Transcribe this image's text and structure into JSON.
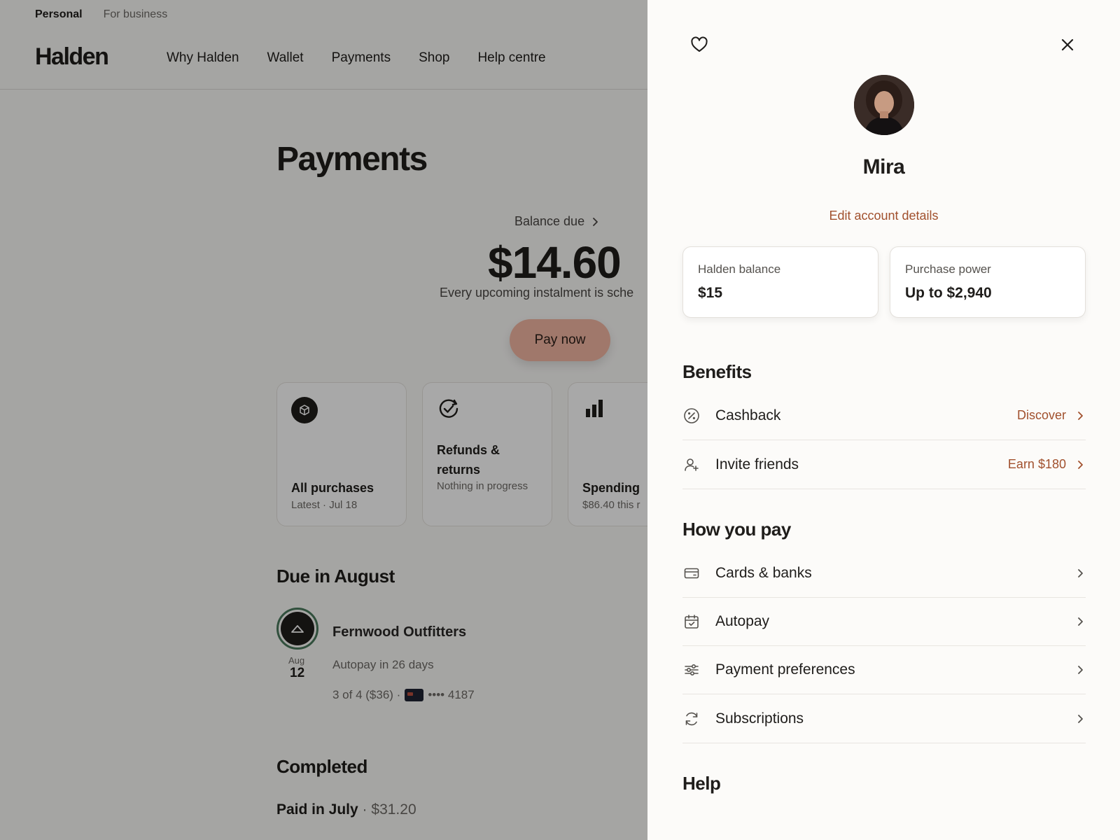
{
  "topbar": {
    "personal": "Personal",
    "business": "For business"
  },
  "header": {
    "logo": "Halden",
    "nav": [
      "Why Halden",
      "Wallet",
      "Payments",
      "Shop",
      "Help centre"
    ]
  },
  "main": {
    "title": "Payments",
    "balance_label": "Balance due",
    "balance_amount": "$14.60",
    "balance_note": "Every upcoming instalment is sche",
    "pay_button": "Pay now",
    "tiles": [
      {
        "title": "All purchases",
        "sub": "Latest · Jul 18"
      },
      {
        "title": "Refunds & returns",
        "sub": "Nothing in progress"
      },
      {
        "title": "Spending",
        "sub": "$86.40 this r"
      }
    ],
    "due_section": "Due in August",
    "due_item": {
      "month": "Aug",
      "day": "12",
      "merchant": "Fernwood Outfitters",
      "autopay": "Autopay in 26 days",
      "installment": "3 of 4 ($36) ·",
      "card_last4": "•••• 4187"
    },
    "completed_section": "Completed",
    "paid_label": "Paid in July",
    "paid_sep": "·",
    "paid_amount": "$31.20"
  },
  "panel": {
    "name": "Mira",
    "edit_link": "Edit account details",
    "halden_balance_label": "Halden balance",
    "halden_balance_value": "$15",
    "purchase_power_label": "Purchase power",
    "purchase_power_value": "Up to $2,940",
    "benefits_title": "Benefits",
    "benefits": [
      {
        "label": "Cashback",
        "action": "Discover",
        "icon": "percent-icon"
      },
      {
        "label": "Invite friends",
        "action": "Earn $180",
        "icon": "add-user-icon"
      }
    ],
    "howpay_title": "How you pay",
    "howpay": [
      {
        "label": "Cards & banks",
        "icon": "card-icon"
      },
      {
        "label": "Autopay",
        "icon": "calendar-check-icon"
      },
      {
        "label": "Payment preferences",
        "icon": "sliders-icon"
      },
      {
        "label": "Subscriptions",
        "icon": "refresh-icon"
      }
    ],
    "help_title": "Help"
  },
  "colors": {
    "accent": "#a1502d",
    "button": "#f3b7a3",
    "ring": "#4b7a5d"
  }
}
